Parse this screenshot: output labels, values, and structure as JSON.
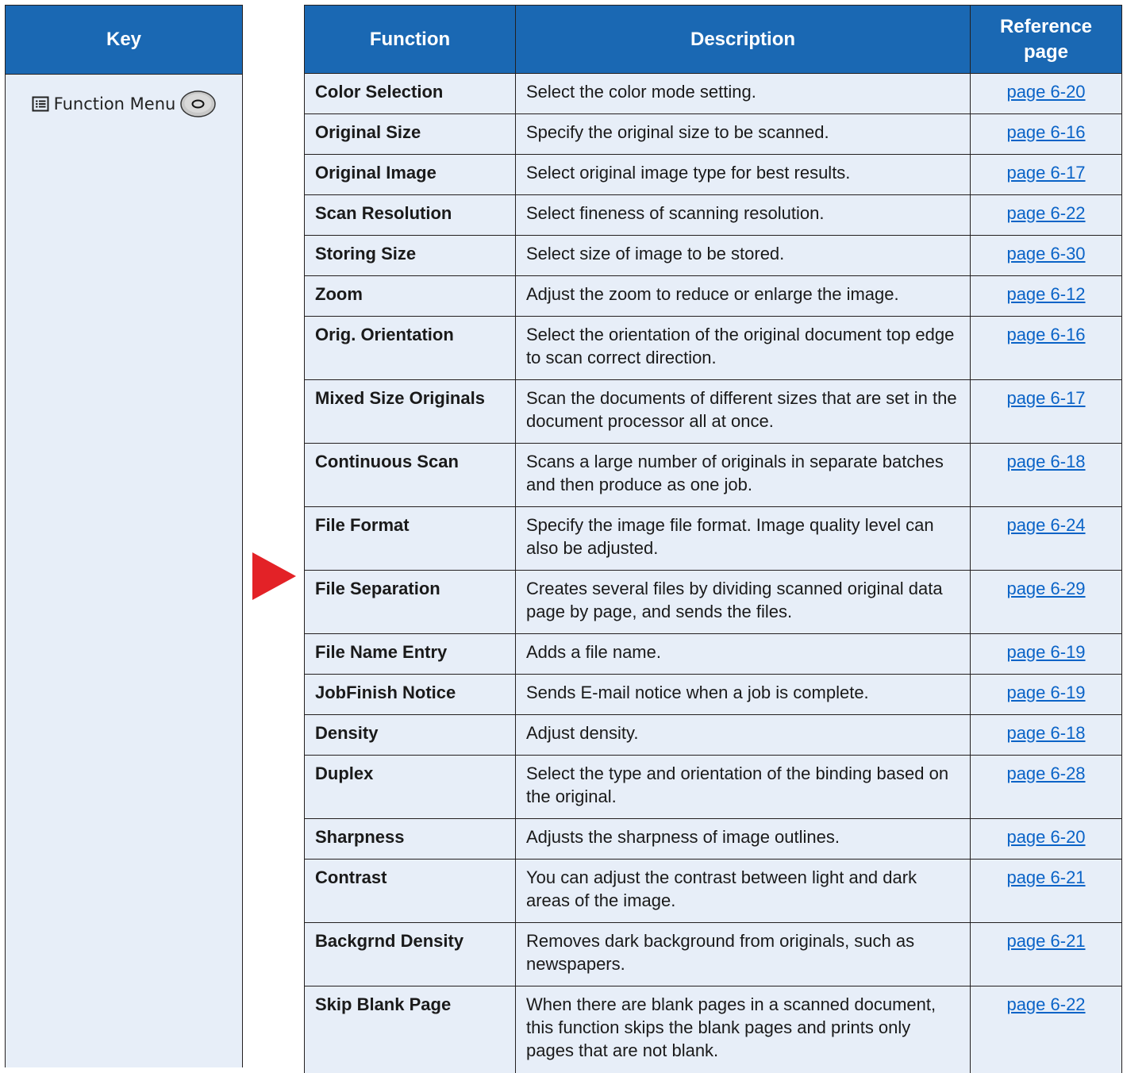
{
  "key_column": {
    "header": "Key",
    "entry_label": "Function Menu"
  },
  "table": {
    "headers": {
      "function": "Function",
      "description": "Description",
      "reference": "Reference page"
    },
    "rows": [
      {
        "function": "Color Selection",
        "description": "Select the color mode setting.",
        "page": "page 6-20"
      },
      {
        "function": "Original Size",
        "description": "Specify the original size to be scanned.",
        "page": "page 6-16"
      },
      {
        "function": "Original Image",
        "description": "Select original image type for best results.",
        "page": "page 6-17"
      },
      {
        "function": "Scan Resolution",
        "description": "Select fineness of scanning resolution.",
        "page": "page 6-22"
      },
      {
        "function": "Storing Size",
        "description": "Select size of image to be stored.",
        "page": "page 6-30"
      },
      {
        "function": "Zoom",
        "description": "Adjust the zoom to reduce or enlarge the image.",
        "page": "page 6-12"
      },
      {
        "function": "Orig. Orientation",
        "description": "Select the orientation of the original document top edge to scan correct direction.",
        "page": "page 6-16"
      },
      {
        "function": "Mixed Size Originals",
        "description": "Scan the documents of different sizes that are set in the document processor all at once.",
        "page": "page 6-17"
      },
      {
        "function": "Continuous Scan",
        "description": "Scans a large number of originals in separate batches and then produce as one job.",
        "page": "page 6-18"
      },
      {
        "function": "File Format",
        "description": "Specify the image file format. Image quality level can also be adjusted.",
        "page": "page 6-24"
      },
      {
        "function": "File Separation",
        "description": "Creates several files by dividing scanned original data page by page, and sends the files.",
        "page": "page 6-29"
      },
      {
        "function": "File Name Entry",
        "description": "Adds a file name.",
        "page": "page 6-19"
      },
      {
        "function": "JobFinish Notice",
        "description": "Sends E-mail notice when a job is complete.",
        "page": "page 6-19"
      },
      {
        "function": "Density",
        "description": "Adjust density.",
        "page": "page 6-18"
      },
      {
        "function": "Duplex",
        "description": "Select the type and orientation of the binding based on the original.",
        "page": "page 6-28"
      },
      {
        "function": "Sharpness",
        "description": "Adjusts the sharpness of image outlines.",
        "page": "page 6-20"
      },
      {
        "function": "Contrast",
        "description": "You can adjust the contrast between light and dark areas of the image.",
        "page": "page 6-21"
      },
      {
        "function": "Backgrnd Density",
        "description": "Removes dark background from originals, such as newspapers.",
        "page": "page 6-21"
      },
      {
        "function": "Skip Blank Page",
        "description": "When there are blank pages in a scanned document, this function skips the blank pages and prints only pages that are not blank.",
        "page": "page 6-22"
      }
    ]
  },
  "icons": {
    "menu_icon": "function-menu-icon",
    "key_icon": "oval-key-icon",
    "arrow_icon": "right-arrow-icon"
  },
  "colors": {
    "header_blue": "#1a68b3",
    "cell_background": "#e7eef8",
    "link_blue": "#0a63c7",
    "arrow_red": "#e32227"
  }
}
